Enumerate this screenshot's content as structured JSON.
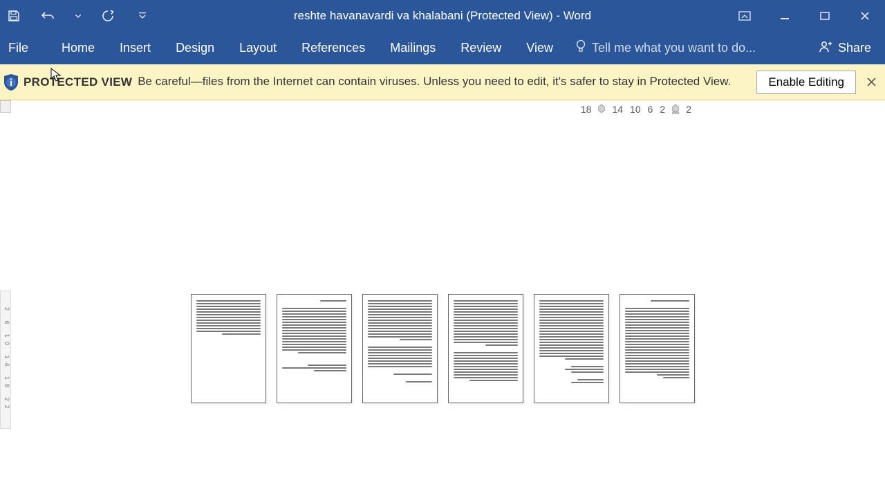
{
  "titlebar": {
    "title": "reshte havanavardi va khalabani (Protected View) - Word"
  },
  "ribbon": {
    "tabs": {
      "file": "File",
      "home": "Home",
      "insert": "Insert",
      "design": "Design",
      "layout": "Layout",
      "references": "References",
      "mailings": "Mailings",
      "review": "Review",
      "view": "View"
    },
    "tell_me_placeholder": "Tell me what you want to do...",
    "share_label": "Share"
  },
  "protected_view": {
    "title": "PROTECTED VIEW",
    "message": "Be careful—files from the Internet can contain viruses. Unless you need to edit, it's safer to stay in Protected View.",
    "enable_label": "Enable Editing"
  },
  "ruler": {
    "marks": [
      "18",
      "14",
      "10",
      "6",
      "2",
      "2"
    ]
  },
  "vruler_text": "2   6  10 14 18 22"
}
